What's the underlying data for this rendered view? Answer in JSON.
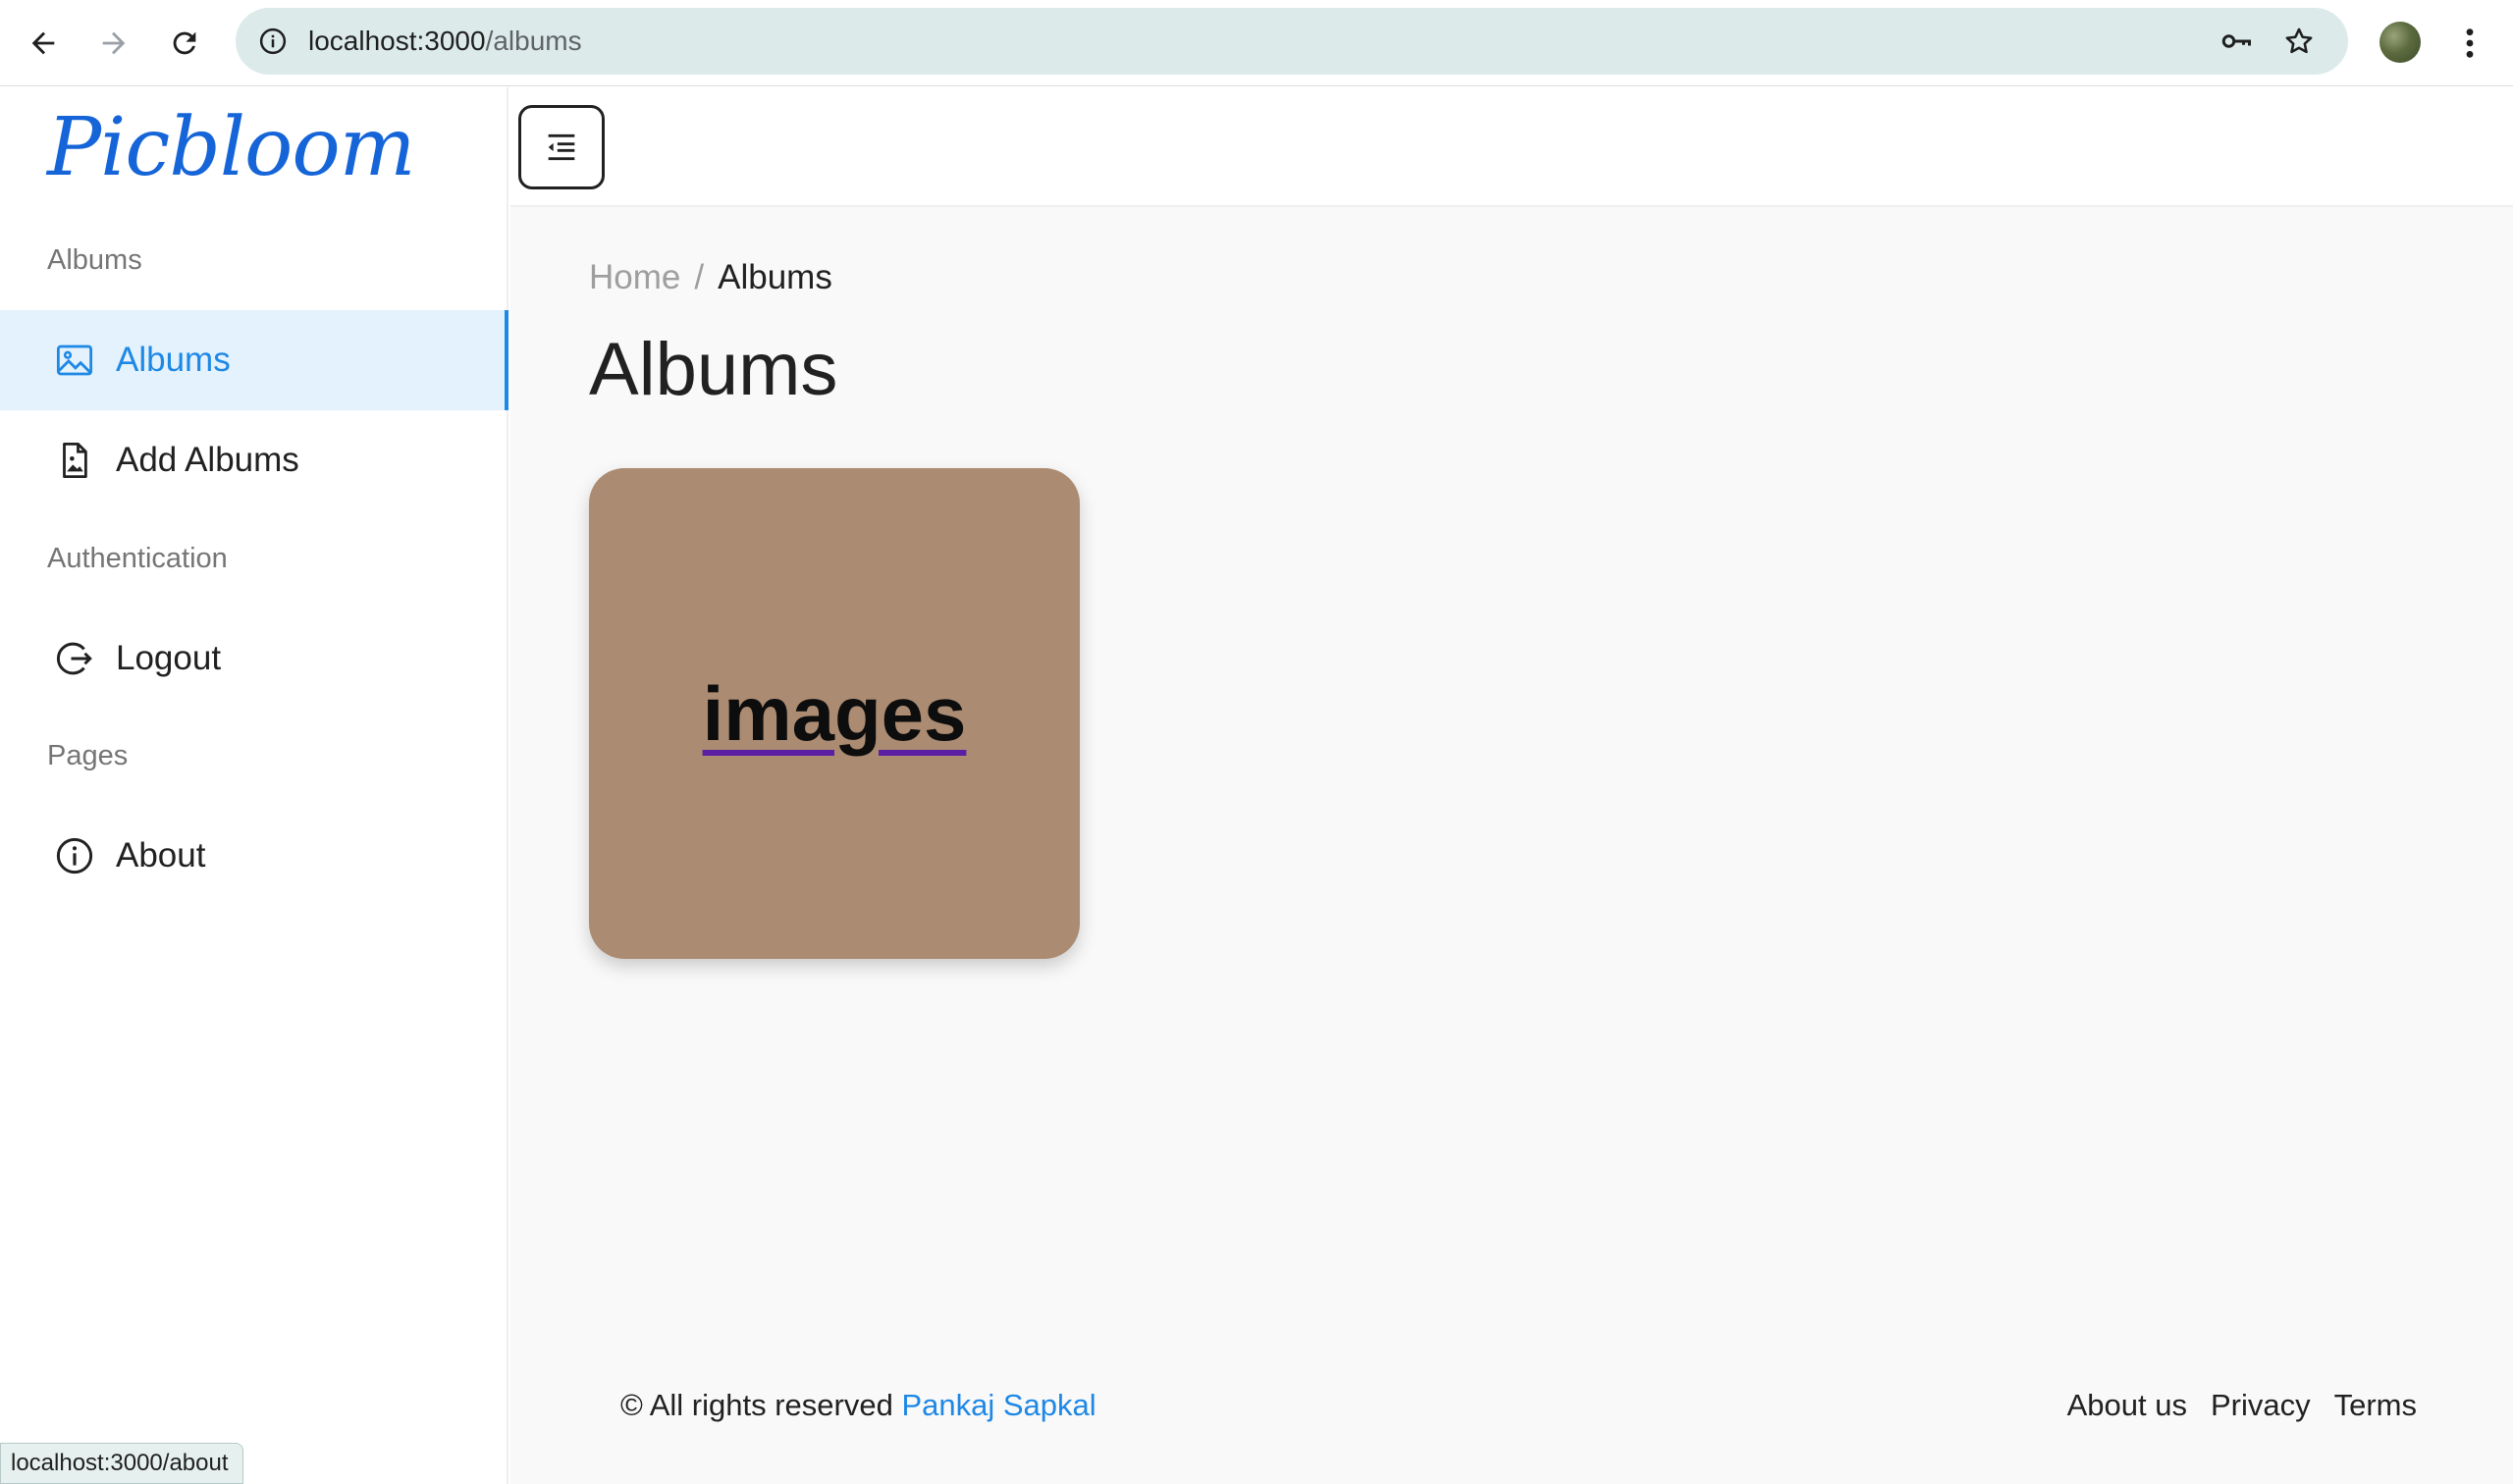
{
  "browser": {
    "url_host": "localhost:3000",
    "url_path": "/albums",
    "status_url": "localhost:3000/about",
    "icons": [
      "back-arrow-icon",
      "forward-arrow-icon",
      "reload-icon",
      "info-icon",
      "password-key-icon",
      "bookmark-star-icon",
      "profile-avatar",
      "more-vert-icon"
    ]
  },
  "sidebar": {
    "brand": "Picbloom",
    "sections": [
      {
        "title": "Albums"
      },
      {
        "title": "Authentication"
      },
      {
        "title": "Pages"
      }
    ],
    "items": [
      {
        "label": "Albums",
        "icon": "image-icon",
        "active": true
      },
      {
        "label": "Add Albums",
        "icon": "file-image-icon",
        "active": false
      },
      {
        "label": "Logout",
        "icon": "logout-icon",
        "active": false
      },
      {
        "label": "About",
        "icon": "info-circle-icon",
        "active": false
      }
    ]
  },
  "topbar": {
    "toggle_icon": "menu-collapse-icon"
  },
  "main": {
    "breadcrumb": {
      "home": "Home",
      "separator": "/",
      "current": "Albums"
    },
    "title": "Albums",
    "albums": [
      {
        "name": "images",
        "color": "#ab8b72"
      }
    ]
  },
  "footer": {
    "prefix": "© All rights reserved",
    "author": "Pankaj Sapkal",
    "links": [
      "About us",
      "Privacy",
      "Terms"
    ]
  },
  "colors": {
    "accent": "#1e88e5",
    "active_bg": "#e3f2fd",
    "brand": "#1565d8",
    "omnibox": "#dcebea"
  }
}
